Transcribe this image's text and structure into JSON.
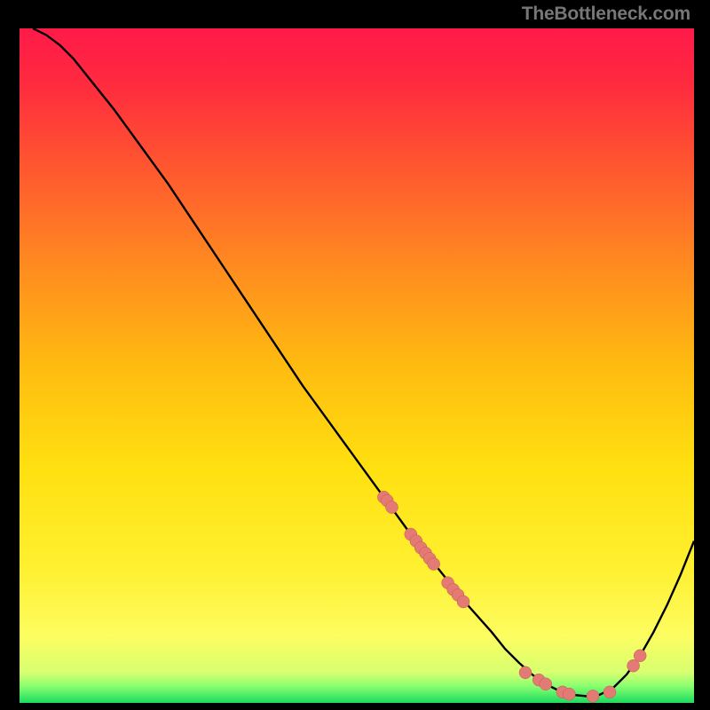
{
  "watermark": "TheBottleneck.com",
  "colors": {
    "background": "#000000",
    "gradient_stops": [
      {
        "offset": 0.0,
        "color": "#ff1a49"
      },
      {
        "offset": 0.08,
        "color": "#ff2a3f"
      },
      {
        "offset": 0.2,
        "color": "#ff5530"
      },
      {
        "offset": 0.35,
        "color": "#ff8a20"
      },
      {
        "offset": 0.5,
        "color": "#ffbb10"
      },
      {
        "offset": 0.65,
        "color": "#ffe010"
      },
      {
        "offset": 0.8,
        "color": "#fff030"
      },
      {
        "offset": 0.9,
        "color": "#fdfd60"
      },
      {
        "offset": 0.955,
        "color": "#d7ff70"
      },
      {
        "offset": 0.975,
        "color": "#8aff70"
      },
      {
        "offset": 1.0,
        "color": "#1bdc60"
      }
    ],
    "curve": "#000000",
    "marker_fill": "#e47a74",
    "marker_stroke": "#c45a52"
  },
  "chart_data": {
    "type": "line",
    "title": "",
    "xlabel": "",
    "ylabel": "",
    "xlim": [
      0,
      100
    ],
    "ylim": [
      0,
      100
    ],
    "grid": false,
    "series": [
      {
        "name": "curve",
        "x": [
          2,
          4,
          6,
          8,
          10,
          14,
          18,
          22,
          26,
          30,
          34,
          38,
          42,
          46,
          50,
          54,
          58,
          62,
          66,
          70,
          72,
          74,
          76,
          78,
          80,
          82,
          84,
          86,
          88,
          90,
          92,
          94,
          96,
          98,
          100
        ],
        "y": [
          100,
          99,
          97.5,
          95.5,
          93,
          88,
          82.5,
          77,
          71,
          65,
          59,
          53,
          47,
          41.5,
          36,
          30.5,
          25,
          20,
          15,
          10.5,
          8,
          6,
          4.2,
          2.8,
          1.8,
          1.2,
          1.0,
          1.2,
          2.2,
          4.2,
          7.0,
          10.5,
          14.5,
          19,
          24
        ]
      }
    ],
    "markers": [
      {
        "x": 54.0,
        "y": 30.5
      },
      {
        "x": 54.5,
        "y": 30.0
      },
      {
        "x": 55.2,
        "y": 29.0
      },
      {
        "x": 58.0,
        "y": 25.0
      },
      {
        "x": 58.8,
        "y": 24.0
      },
      {
        "x": 59.5,
        "y": 23.0
      },
      {
        "x": 60.2,
        "y": 22.2
      },
      {
        "x": 60.8,
        "y": 21.4
      },
      {
        "x": 61.4,
        "y": 20.6
      },
      {
        "x": 63.5,
        "y": 17.8
      },
      {
        "x": 64.3,
        "y": 16.8
      },
      {
        "x": 65.0,
        "y": 16.0
      },
      {
        "x": 65.8,
        "y": 15.0
      },
      {
        "x": 75.0,
        "y": 4.5
      },
      {
        "x": 77.0,
        "y": 3.4
      },
      {
        "x": 78.0,
        "y": 2.8
      },
      {
        "x": 80.5,
        "y": 1.6
      },
      {
        "x": 81.5,
        "y": 1.3
      },
      {
        "x": 85.0,
        "y": 1.0
      },
      {
        "x": 87.5,
        "y": 1.6
      },
      {
        "x": 91.0,
        "y": 5.5
      },
      {
        "x": 92.0,
        "y": 7.0
      }
    ],
    "marker_radius_px": 7
  }
}
